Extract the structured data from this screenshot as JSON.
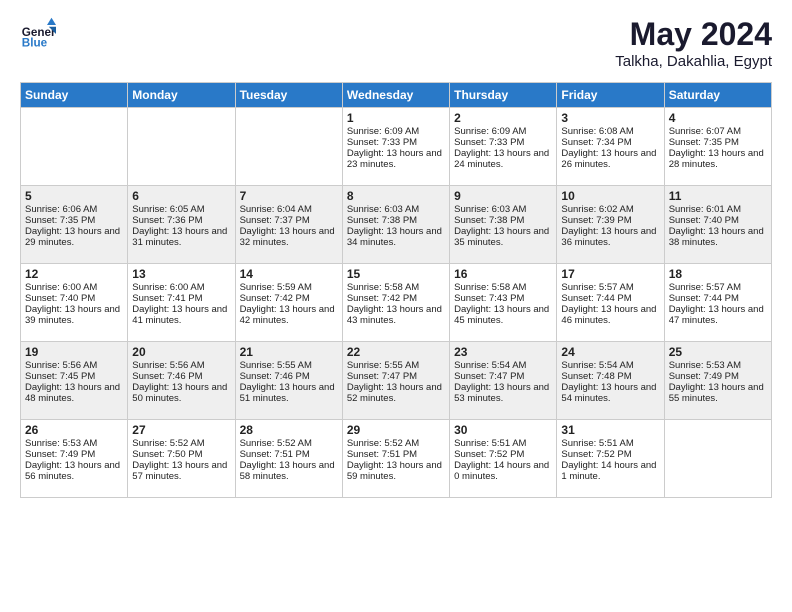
{
  "header": {
    "logo_line1": "General",
    "logo_line2": "Blue",
    "month": "May 2024",
    "location": "Talkha, Dakahlia, Egypt"
  },
  "days_of_week": [
    "Sunday",
    "Monday",
    "Tuesday",
    "Wednesday",
    "Thursday",
    "Friday",
    "Saturday"
  ],
  "weeks": [
    [
      {
        "day": "",
        "sunrise": "",
        "sunset": "",
        "daylight": "",
        "empty": true
      },
      {
        "day": "",
        "sunrise": "",
        "sunset": "",
        "daylight": "",
        "empty": true
      },
      {
        "day": "",
        "sunrise": "",
        "sunset": "",
        "daylight": "",
        "empty": true
      },
      {
        "day": "1",
        "sunrise": "Sunrise: 6:09 AM",
        "sunset": "Sunset: 7:33 PM",
        "daylight": "Daylight: 13 hours and 23 minutes."
      },
      {
        "day": "2",
        "sunrise": "Sunrise: 6:09 AM",
        "sunset": "Sunset: 7:33 PM",
        "daylight": "Daylight: 13 hours and 24 minutes."
      },
      {
        "day": "3",
        "sunrise": "Sunrise: 6:08 AM",
        "sunset": "Sunset: 7:34 PM",
        "daylight": "Daylight: 13 hours and 26 minutes."
      },
      {
        "day": "4",
        "sunrise": "Sunrise: 6:07 AM",
        "sunset": "Sunset: 7:35 PM",
        "daylight": "Daylight: 13 hours and 28 minutes."
      }
    ],
    [
      {
        "day": "5",
        "sunrise": "Sunrise: 6:06 AM",
        "sunset": "Sunset: 7:35 PM",
        "daylight": "Daylight: 13 hours and 29 minutes."
      },
      {
        "day": "6",
        "sunrise": "Sunrise: 6:05 AM",
        "sunset": "Sunset: 7:36 PM",
        "daylight": "Daylight: 13 hours and 31 minutes."
      },
      {
        "day": "7",
        "sunrise": "Sunrise: 6:04 AM",
        "sunset": "Sunset: 7:37 PM",
        "daylight": "Daylight: 13 hours and 32 minutes."
      },
      {
        "day": "8",
        "sunrise": "Sunrise: 6:03 AM",
        "sunset": "Sunset: 7:38 PM",
        "daylight": "Daylight: 13 hours and 34 minutes."
      },
      {
        "day": "9",
        "sunrise": "Sunrise: 6:03 AM",
        "sunset": "Sunset: 7:38 PM",
        "daylight": "Daylight: 13 hours and 35 minutes."
      },
      {
        "day": "10",
        "sunrise": "Sunrise: 6:02 AM",
        "sunset": "Sunset: 7:39 PM",
        "daylight": "Daylight: 13 hours and 36 minutes."
      },
      {
        "day": "11",
        "sunrise": "Sunrise: 6:01 AM",
        "sunset": "Sunset: 7:40 PM",
        "daylight": "Daylight: 13 hours and 38 minutes."
      }
    ],
    [
      {
        "day": "12",
        "sunrise": "Sunrise: 6:00 AM",
        "sunset": "Sunset: 7:40 PM",
        "daylight": "Daylight: 13 hours and 39 minutes."
      },
      {
        "day": "13",
        "sunrise": "Sunrise: 6:00 AM",
        "sunset": "Sunset: 7:41 PM",
        "daylight": "Daylight: 13 hours and 41 minutes."
      },
      {
        "day": "14",
        "sunrise": "Sunrise: 5:59 AM",
        "sunset": "Sunset: 7:42 PM",
        "daylight": "Daylight: 13 hours and 42 minutes."
      },
      {
        "day": "15",
        "sunrise": "Sunrise: 5:58 AM",
        "sunset": "Sunset: 7:42 PM",
        "daylight": "Daylight: 13 hours and 43 minutes."
      },
      {
        "day": "16",
        "sunrise": "Sunrise: 5:58 AM",
        "sunset": "Sunset: 7:43 PM",
        "daylight": "Daylight: 13 hours and 45 minutes."
      },
      {
        "day": "17",
        "sunrise": "Sunrise: 5:57 AM",
        "sunset": "Sunset: 7:44 PM",
        "daylight": "Daylight: 13 hours and 46 minutes."
      },
      {
        "day": "18",
        "sunrise": "Sunrise: 5:57 AM",
        "sunset": "Sunset: 7:44 PM",
        "daylight": "Daylight: 13 hours and 47 minutes."
      }
    ],
    [
      {
        "day": "19",
        "sunrise": "Sunrise: 5:56 AM",
        "sunset": "Sunset: 7:45 PM",
        "daylight": "Daylight: 13 hours and 48 minutes."
      },
      {
        "day": "20",
        "sunrise": "Sunrise: 5:56 AM",
        "sunset": "Sunset: 7:46 PM",
        "daylight": "Daylight: 13 hours and 50 minutes."
      },
      {
        "day": "21",
        "sunrise": "Sunrise: 5:55 AM",
        "sunset": "Sunset: 7:46 PM",
        "daylight": "Daylight: 13 hours and 51 minutes."
      },
      {
        "day": "22",
        "sunrise": "Sunrise: 5:55 AM",
        "sunset": "Sunset: 7:47 PM",
        "daylight": "Daylight: 13 hours and 52 minutes."
      },
      {
        "day": "23",
        "sunrise": "Sunrise: 5:54 AM",
        "sunset": "Sunset: 7:47 PM",
        "daylight": "Daylight: 13 hours and 53 minutes."
      },
      {
        "day": "24",
        "sunrise": "Sunrise: 5:54 AM",
        "sunset": "Sunset: 7:48 PM",
        "daylight": "Daylight: 13 hours and 54 minutes."
      },
      {
        "day": "25",
        "sunrise": "Sunrise: 5:53 AM",
        "sunset": "Sunset: 7:49 PM",
        "daylight": "Daylight: 13 hours and 55 minutes."
      }
    ],
    [
      {
        "day": "26",
        "sunrise": "Sunrise: 5:53 AM",
        "sunset": "Sunset: 7:49 PM",
        "daylight": "Daylight: 13 hours and 56 minutes."
      },
      {
        "day": "27",
        "sunrise": "Sunrise: 5:52 AM",
        "sunset": "Sunset: 7:50 PM",
        "daylight": "Daylight: 13 hours and 57 minutes."
      },
      {
        "day": "28",
        "sunrise": "Sunrise: 5:52 AM",
        "sunset": "Sunset: 7:51 PM",
        "daylight": "Daylight: 13 hours and 58 minutes."
      },
      {
        "day": "29",
        "sunrise": "Sunrise: 5:52 AM",
        "sunset": "Sunset: 7:51 PM",
        "daylight": "Daylight: 13 hours and 59 minutes."
      },
      {
        "day": "30",
        "sunrise": "Sunrise: 5:51 AM",
        "sunset": "Sunset: 7:52 PM",
        "daylight": "Daylight: 14 hours and 0 minutes."
      },
      {
        "day": "31",
        "sunrise": "Sunrise: 5:51 AM",
        "sunset": "Sunset: 7:52 PM",
        "daylight": "Daylight: 14 hours and 1 minute."
      },
      {
        "day": "",
        "sunrise": "",
        "sunset": "",
        "daylight": "",
        "empty": true
      }
    ]
  ]
}
